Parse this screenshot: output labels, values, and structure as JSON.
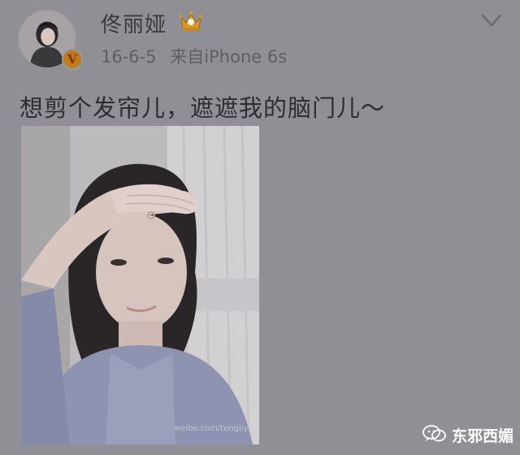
{
  "user": {
    "name": "佟丽娅",
    "verified_badge": "V",
    "crown_color": "#d69a2a"
  },
  "meta": {
    "date": "16-6-5",
    "source": "来自iPhone 6s"
  },
  "post": {
    "text": "想剪个发帘儿，遮遮我的脑门儿～"
  },
  "photo": {
    "watermark": "weibo.com/tongliya"
  },
  "footer": {
    "brand": "东邪西媚"
  },
  "icons": {
    "crown": "crown-icon",
    "chevron": "chevron-down-icon",
    "wechat": "wechat-icon"
  },
  "colors": {
    "background": "#8f8f95",
    "text": "#2e2e32",
    "meta": "#5e5e63"
  }
}
